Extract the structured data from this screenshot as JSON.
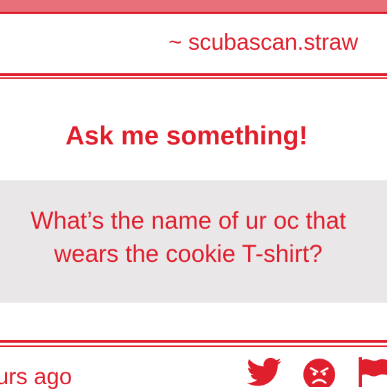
{
  "header": {
    "site_url": "~ scubascan.straw"
  },
  "card": {
    "heading": "Ask me something!",
    "question": "What’s the name of ur oc that wears the cookie T-shirt?"
  },
  "footer": {
    "time_ago": "urs ago",
    "icons": [
      "twitter-icon",
      "angry-face-icon",
      "flag-icon"
    ]
  },
  "colors": {
    "accent": "#e01f2d",
    "top_bar": "#e8707a",
    "question_bg": "#e9e7e8",
    "background": "#ffffff"
  }
}
